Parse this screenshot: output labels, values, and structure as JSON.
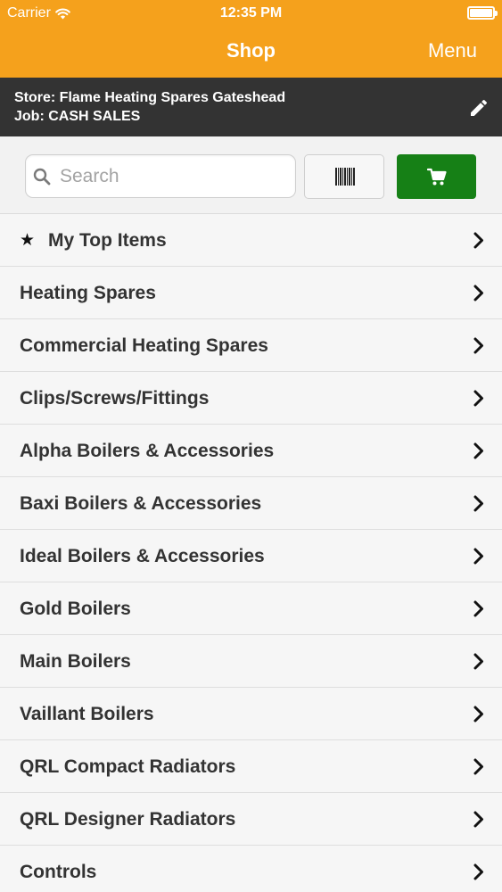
{
  "status_bar": {
    "carrier": "Carrier",
    "time": "12:35 PM"
  },
  "nav": {
    "title": "Shop",
    "menu_label": "Menu"
  },
  "store_info": {
    "store_line": "Store: Flame Heating Spares Gateshead",
    "job_line": "Job: CASH SALES"
  },
  "search": {
    "placeholder": "Search",
    "value": ""
  },
  "categories": [
    {
      "label": "My Top Items",
      "starred": true
    },
    {
      "label": "Heating Spares"
    },
    {
      "label": "Commercial Heating Spares"
    },
    {
      "label": "Clips/Screws/Fittings"
    },
    {
      "label": "Alpha Boilers & Accessories"
    },
    {
      "label": "Baxi Boilers & Accessories"
    },
    {
      "label": "Ideal Boilers & Accessories"
    },
    {
      "label": "Gold Boilers"
    },
    {
      "label": "Main Boilers"
    },
    {
      "label": "Vaillant Boilers"
    },
    {
      "label": "QRL Compact Radiators"
    },
    {
      "label": "QRL Designer Radiators"
    },
    {
      "label": "Controls"
    }
  ],
  "colors": {
    "accent": "#f5a11c",
    "store_bar": "#333333",
    "cart_button": "#168016"
  },
  "icons": {
    "wifi": "wifi-icon",
    "battery": "battery-icon",
    "edit": "pencil-icon",
    "search": "search-icon",
    "barcode": "barcode-icon",
    "cart": "cart-icon",
    "star": "star-icon",
    "chevron": "chevron-right-icon"
  }
}
